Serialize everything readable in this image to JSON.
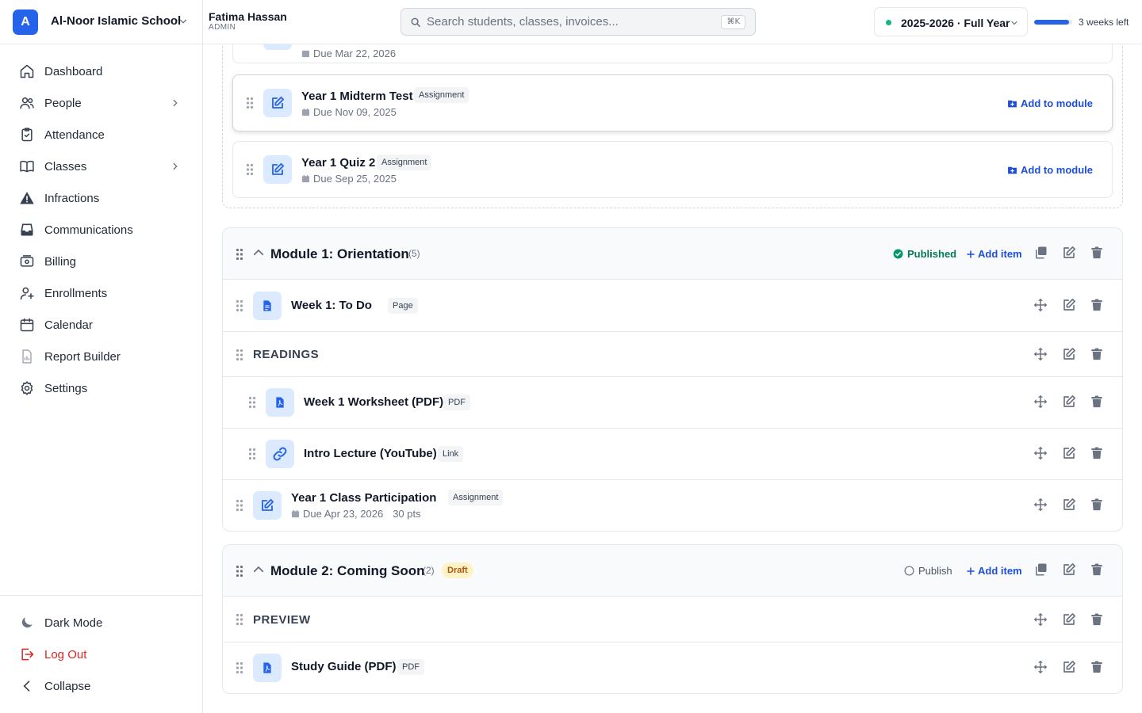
{
  "app": {
    "logo_letter": "A",
    "school_name": "Al-Noor Islamic School",
    "user_name": "Fatima Hassan",
    "user_role": "ADMIN",
    "search_placeholder": "Search students, classes, invoices...",
    "search_shortcut": "⌘K",
    "school_year": "2025-2026 · Full Year",
    "year_progress_percent": 92,
    "time_left": "3 weeks left",
    "accent_color": "#2563eb"
  },
  "sidebar": {
    "items": [
      {
        "label": "Dashboard",
        "icon": "home-icon"
      },
      {
        "label": "People",
        "icon": "people-icon",
        "expandable": true
      },
      {
        "label": "Attendance",
        "icon": "clipboard-icon"
      },
      {
        "label": "Classes",
        "icon": "book-icon",
        "expandable": true
      },
      {
        "label": "Infractions",
        "icon": "warning-icon"
      },
      {
        "label": "Communications",
        "icon": "inbox-icon"
      },
      {
        "label": "Billing",
        "icon": "billing-icon"
      },
      {
        "label": "Enrollments",
        "icon": "user-plus-icon"
      },
      {
        "label": "Calendar",
        "icon": "calendar-icon"
      },
      {
        "label": "Report Builder",
        "icon": "report-icon"
      },
      {
        "label": "Settings",
        "icon": "gear-icon"
      }
    ],
    "bottom": {
      "dark_mode": "Dark Mode",
      "logout": "Log Out",
      "collapse": "Collapse"
    }
  },
  "unassigned": {
    "partial_due": "Due Mar 22, 2026",
    "add_to_module": "Add to module",
    "items": [
      {
        "title": "Year 1 Midterm Test",
        "type": "Assignment",
        "due": "Due Nov 09, 2025"
      },
      {
        "title": "Year 1 Quiz 2",
        "type": "Assignment",
        "due": "Due Sep 25, 2025"
      }
    ]
  },
  "modules": [
    {
      "title": "Module 1: Orientation",
      "count": "(5)",
      "status": "Published",
      "add_item": "Add item",
      "rows": [
        {
          "kind": "item",
          "title": "Week 1: To Do",
          "type": "Page",
          "icon": "page-icon"
        },
        {
          "kind": "header",
          "title": "READINGS"
        },
        {
          "kind": "item",
          "title": "Week 1 Worksheet (PDF)",
          "type": "PDF",
          "icon": "pdf-icon",
          "indented": true
        },
        {
          "kind": "item",
          "title": "Intro Lecture (YouTube)",
          "type": "Link",
          "icon": "link-icon",
          "indented": true
        },
        {
          "kind": "item",
          "title": "Year 1 Class Participation",
          "type": "Assignment",
          "icon": "assignment-icon",
          "due": "Due Apr 23, 2026",
          "points": "30 pts"
        }
      ]
    },
    {
      "title": "Module 2: Coming Soon",
      "count": "(2)",
      "badge": "Draft",
      "status": "Publish",
      "add_item": "Add item",
      "rows": [
        {
          "kind": "header",
          "title": "PREVIEW"
        },
        {
          "kind": "item",
          "title": "Study Guide (PDF)",
          "type": "PDF",
          "icon": "pdf-icon"
        }
      ]
    }
  ]
}
